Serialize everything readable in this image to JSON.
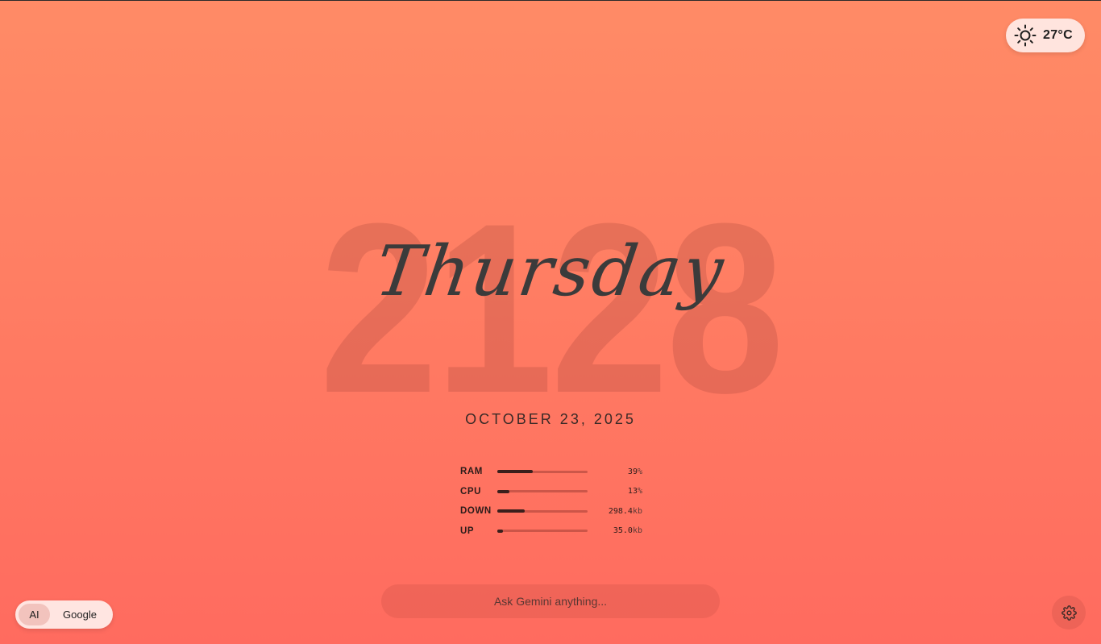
{
  "weather": {
    "icon": "sun-icon",
    "temperature": "27°C"
  },
  "clock": {
    "time": "2128",
    "weekday": "Thursday",
    "date": "OCTOBER 23, 2025"
  },
  "stats": [
    {
      "label": "RAM",
      "fill": 0.39,
      "value": "39",
      "unit": "%"
    },
    {
      "label": "CPU",
      "fill": 0.13,
      "value": "13",
      "unit": "%"
    },
    {
      "label": "DOWN",
      "fill": 0.3,
      "value": "298.4",
      "unit": "kb"
    },
    {
      "label": "UP",
      "fill": 0.06,
      "value": "35.0",
      "unit": "kb"
    }
  ],
  "search": {
    "placeholder": "Ask Gemini anything..."
  },
  "mode_toggle": {
    "ai_label": "AI",
    "google_label": "Google"
  },
  "settings": {
    "icon": "gear-icon"
  },
  "colors": {
    "gradient_top": "#ff8b66",
    "gradient_bottom": "#ff6b5f",
    "text": "#3b3b3b"
  }
}
